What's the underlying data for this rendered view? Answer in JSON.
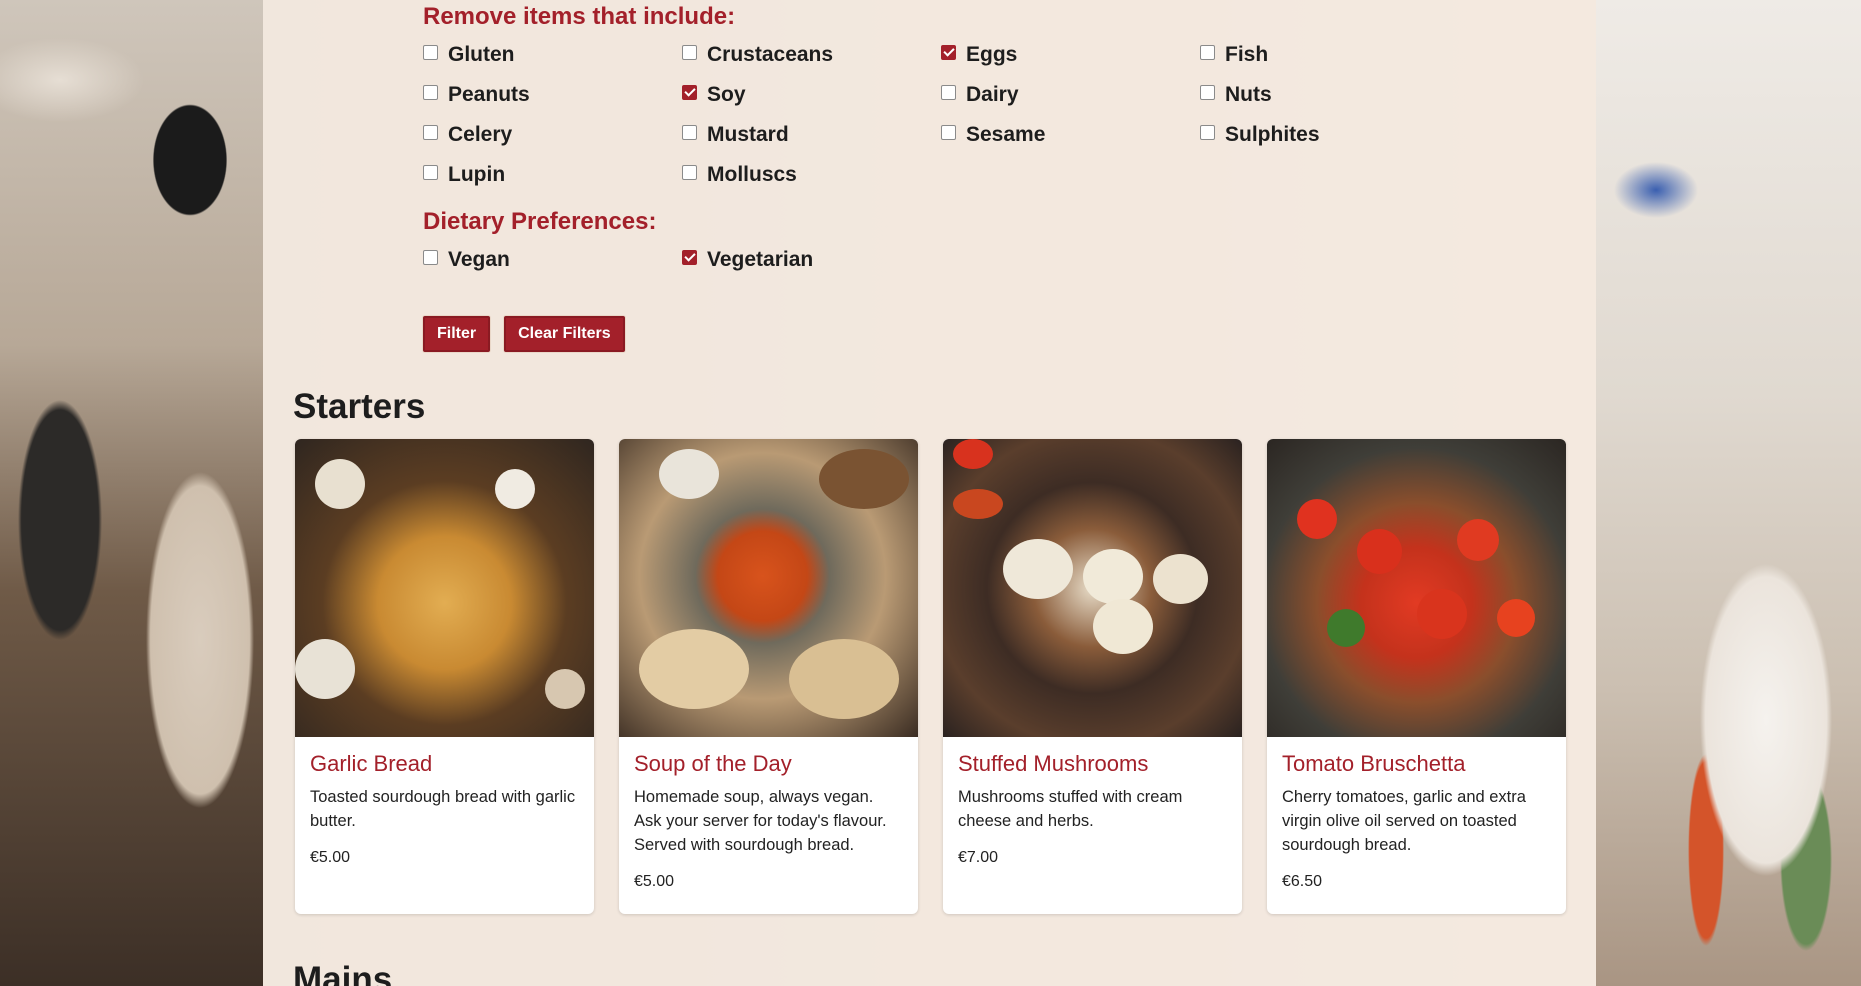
{
  "filters": {
    "remove_heading": "Remove items that include:",
    "allergens": [
      {
        "label": "Gluten",
        "checked": false
      },
      {
        "label": "Crustaceans",
        "checked": false
      },
      {
        "label": "Eggs",
        "checked": true
      },
      {
        "label": "Fish",
        "checked": false
      },
      {
        "label": "Peanuts",
        "checked": false
      },
      {
        "label": "Soy",
        "checked": true
      },
      {
        "label": "Dairy",
        "checked": false
      },
      {
        "label": "Nuts",
        "checked": false
      },
      {
        "label": "Celery",
        "checked": false
      },
      {
        "label": "Mustard",
        "checked": false
      },
      {
        "label": "Sesame",
        "checked": false
      },
      {
        "label": "Sulphites",
        "checked": false
      },
      {
        "label": "Lupin",
        "checked": false
      },
      {
        "label": "Molluscs",
        "checked": false
      }
    ],
    "dietary_heading": "Dietary Preferences:",
    "dietary": [
      {
        "label": "Vegan",
        "checked": false
      },
      {
        "label": "Vegetarian",
        "checked": true
      }
    ],
    "filter_button": "Filter",
    "clear_button": "Clear Filters"
  },
  "menu": {
    "sections": [
      {
        "title": "Starters",
        "items": [
          {
            "name": "Garlic Bread",
            "description": "Toasted sourdough bread with garlic butter.",
            "price": "€5.00",
            "image_icon": "garlic-bread-image"
          },
          {
            "name": "Soup of the Day",
            "description": "Homemade soup, always vegan. Ask your server for today's flavour. Served with sourdough bread.",
            "price": "€5.00",
            "image_icon": "soup-image"
          },
          {
            "name": "Stuffed Mushrooms",
            "description": "Mushrooms stuffed with cream cheese and herbs.",
            "price": "€7.00",
            "image_icon": "mushrooms-image"
          },
          {
            "name": "Tomato Bruschetta",
            "description": "Cherry tomatoes, garlic and extra virgin olive oil served on toasted sourdough bread.",
            "price": "€6.50",
            "image_icon": "bruschetta-image"
          }
        ]
      },
      {
        "title": "Mains"
      }
    ]
  },
  "colors": {
    "accent": "#a3202a",
    "panel": "#f4eae0",
    "text": "#1d1d1d"
  }
}
